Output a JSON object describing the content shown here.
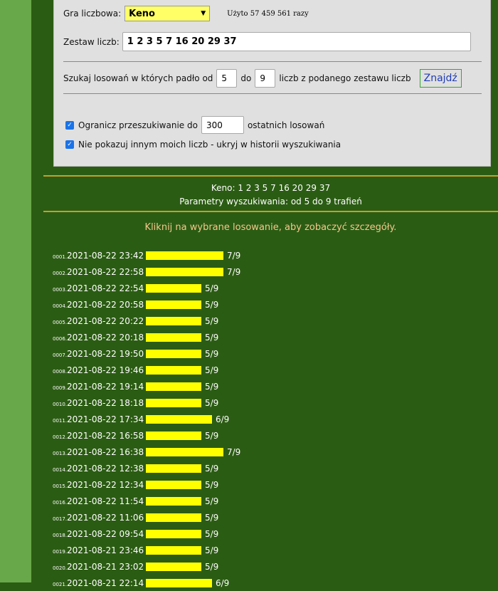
{
  "form": {
    "game_label": "Gra liczbowa:",
    "game_value": "Keno",
    "used_text": "Użyto 57 459 561 razy",
    "set_label": "Zestaw liczb:",
    "set_value": "1 2 3 5 7 16 20 29 37",
    "search_prefix": "Szukaj losowań w których padło od",
    "from_value": "5",
    "to_label": "do",
    "to_value": "9",
    "search_suffix": "liczb z podanego zestawu liczb",
    "find_button": "Znajdź",
    "limit_label": "Ogranicz przeszukiwanie do",
    "limit_value": "300",
    "limit_suffix": "ostatnich losowań",
    "limit_checked": true,
    "hide_label": "Nie pokazuj innym moich liczb - ukryj w historii wyszukiwania",
    "hide_checked": true
  },
  "summary": {
    "game_line": "Keno: 1 2 3 5 7 16 20 29 37",
    "params_line": "Parametry wyszukiwania: od 5 do 9 trafień"
  },
  "click_hint": "Kliknij na wybrane losowanie, aby zobaczyć szczegóły.",
  "colors": {
    "bar": "#ffff00",
    "background": "#2b5c13",
    "sidebar": "#68a84a",
    "accent_line": "#c2a12a"
  },
  "draws": [
    {
      "index": "0001.",
      "datetime": "2021-08-22 23:42",
      "hits": 7,
      "total": 9,
      "score": "7/9"
    },
    {
      "index": "0002.",
      "datetime": "2021-08-22 22:58",
      "hits": 7,
      "total": 9,
      "score": "7/9"
    },
    {
      "index": "0003.",
      "datetime": "2021-08-22 22:54",
      "hits": 5,
      "total": 9,
      "score": "5/9"
    },
    {
      "index": "0004.",
      "datetime": "2021-08-22 20:58",
      "hits": 5,
      "total": 9,
      "score": "5/9"
    },
    {
      "index": "0005.",
      "datetime": "2021-08-22 20:22",
      "hits": 5,
      "total": 9,
      "score": "5/9"
    },
    {
      "index": "0006.",
      "datetime": "2021-08-22 20:18",
      "hits": 5,
      "total": 9,
      "score": "5/9"
    },
    {
      "index": "0007.",
      "datetime": "2021-08-22 19:50",
      "hits": 5,
      "total": 9,
      "score": "5/9"
    },
    {
      "index": "0008.",
      "datetime": "2021-08-22 19:46",
      "hits": 5,
      "total": 9,
      "score": "5/9"
    },
    {
      "index": "0009.",
      "datetime": "2021-08-22 19:14",
      "hits": 5,
      "total": 9,
      "score": "5/9"
    },
    {
      "index": "0010.",
      "datetime": "2021-08-22 18:18",
      "hits": 5,
      "total": 9,
      "score": "5/9"
    },
    {
      "index": "0011.",
      "datetime": "2021-08-22 17:34",
      "hits": 6,
      "total": 9,
      "score": "6/9"
    },
    {
      "index": "0012.",
      "datetime": "2021-08-22 16:58",
      "hits": 5,
      "total": 9,
      "score": "5/9"
    },
    {
      "index": "0013.",
      "datetime": "2021-08-22 16:38",
      "hits": 7,
      "total": 9,
      "score": "7/9"
    },
    {
      "index": "0014.",
      "datetime": "2021-08-22 12:38",
      "hits": 5,
      "total": 9,
      "score": "5/9"
    },
    {
      "index": "0015.",
      "datetime": "2021-08-22 12:34",
      "hits": 5,
      "total": 9,
      "score": "5/9"
    },
    {
      "index": "0016.",
      "datetime": "2021-08-22 11:54",
      "hits": 5,
      "total": 9,
      "score": "5/9"
    },
    {
      "index": "0017.",
      "datetime": "2021-08-22 11:06",
      "hits": 5,
      "total": 9,
      "score": "5/9"
    },
    {
      "index": "0018.",
      "datetime": "2021-08-22 09:54",
      "hits": 5,
      "total": 9,
      "score": "5/9"
    },
    {
      "index": "0019.",
      "datetime": "2021-08-21 23:46",
      "hits": 5,
      "total": 9,
      "score": "5/9"
    },
    {
      "index": "0020.",
      "datetime": "2021-08-21 23:02",
      "hits": 5,
      "total": 9,
      "score": "5/9"
    },
    {
      "index": "0021.",
      "datetime": "2021-08-21 22:14",
      "hits": 6,
      "total": 9,
      "score": "6/9"
    }
  ]
}
